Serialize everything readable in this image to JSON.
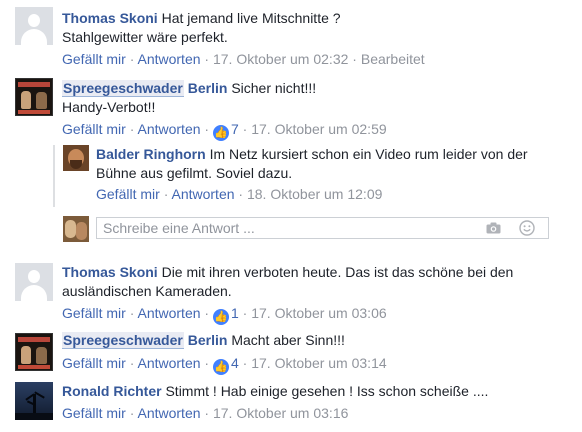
{
  "comments": [
    {
      "author": "Thomas Skoni",
      "line1": "Hat jemand live Mitschnitte ?",
      "line2": "Stahlgewitter wäre perfekt.",
      "like": "Gefällt mir",
      "reply": "Antworten",
      "time": "17. Oktober um 02:32",
      "edited": "Bearbeitet"
    },
    {
      "author_part1": "Spreegeschwader",
      "author_part2": "Berlin",
      "line1": "Sicher nicht!!!",
      "line2": "Handy-Verbot!!",
      "like": "Gefällt mir",
      "reply": "Antworten",
      "likes": "7",
      "time": "17. Oktober um 02:59"
    },
    {
      "author": "Balder Ringhorn",
      "line1": "Im Netz kursiert schon ein Video rum leider von der",
      "line2": "Bühne aus gefilmt. Soviel dazu.",
      "like": "Gefällt mir",
      "reply": "Antworten",
      "time": "18. Oktober um 12:09"
    },
    {
      "author": "Thomas Skoni",
      "line1": "Die mit ihren verboten heute. Das ist das schöne bei den",
      "line2": "ausländischen Kameraden.",
      "like": "Gefällt mir",
      "reply": "Antworten",
      "likes": "1",
      "time": "17. Oktober um 03:06"
    },
    {
      "author_part1": "Spreegeschwader",
      "author_part2": "Berlin",
      "line1": "Macht aber Sinn!!!",
      "like": "Gefällt mir",
      "reply": "Antworten",
      "likes": "4",
      "time": "17. Oktober um 03:14"
    },
    {
      "author": "Ronald Richter",
      "line1": "Stimmt ! Hab einige gesehen ! Iss schon scheiße ....",
      "like": "Gefällt mir",
      "reply": "Antworten",
      "time": "17. Oktober um 03:16"
    }
  ],
  "reply_input": {
    "placeholder": "Schreibe eine Antwort ..."
  },
  "separator": "·",
  "like_glyph": "👍",
  "icons": {
    "camera": "camera-icon",
    "emoji": "smiley-icon"
  },
  "colors": {
    "link": "#365899",
    "meta": "#90949c",
    "like_badge": "#4080ff"
  }
}
